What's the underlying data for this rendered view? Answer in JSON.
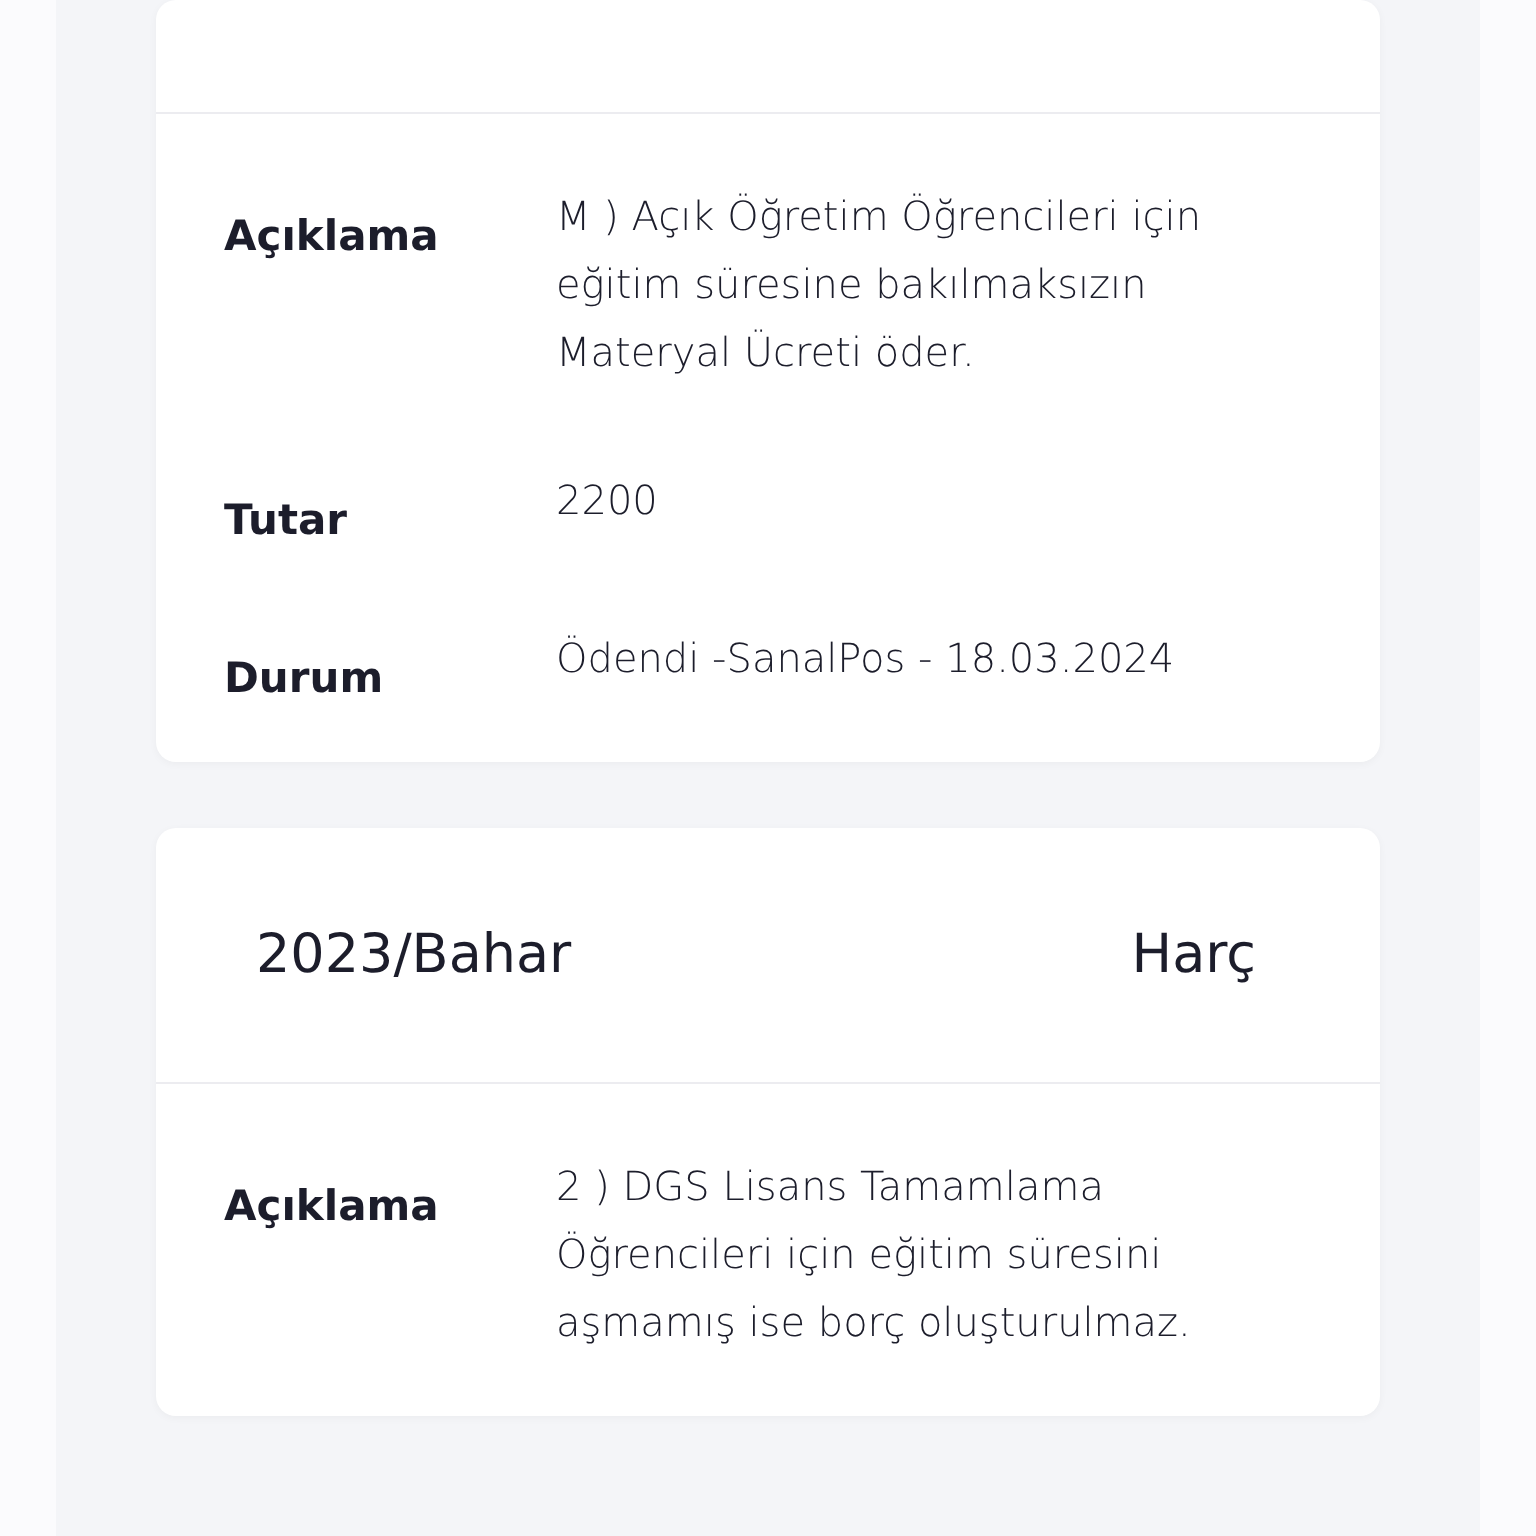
{
  "cards": [
    {
      "rows": [
        {
          "label": "Açıklama",
          "value_lines": [
            "M ) Açık Öğretim Öğrencileri için",
            "eğitim süresine bakılmaksızın",
            "Materyal Ücreti öder."
          ]
        },
        {
          "label": "Tutar",
          "value_lines": [
            "2200"
          ]
        },
        {
          "label": "Durum",
          "value_lines": [
            "Ödendi -SanalPos - 18.03.2024"
          ]
        }
      ]
    },
    {
      "period": "2023/Bahar",
      "type": "Harç",
      "rows": [
        {
          "label": "Açıklama",
          "value_lines": [
            "2 ) DGS Lisans Tamamlama",
            "Öğrencileri için eğitim süresini",
            "aşmamış ise borç oluşturulmaz."
          ]
        }
      ]
    }
  ]
}
